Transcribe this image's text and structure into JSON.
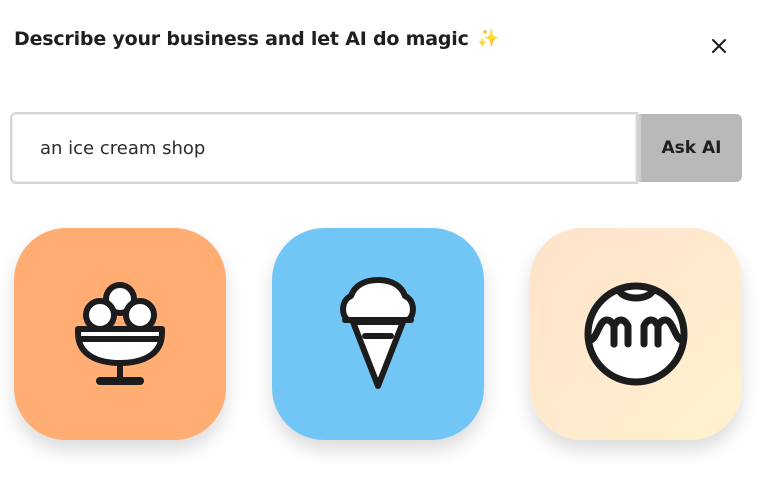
{
  "modal": {
    "title": "Describe your business and let AI do magic",
    "title_emoji": "✨",
    "close_icon": "close-icon"
  },
  "search": {
    "value": "an ice cream shop",
    "placeholder": "",
    "button_label": "Ask AI"
  },
  "results": {
    "icons": [
      {
        "icon": "ice-cream-sundae-icon",
        "background": "#FFAD72"
      },
      {
        "icon": "ice-cream-cone-icon",
        "background": "#72C6F5"
      },
      {
        "icon": "ice-cream-scoop-face-icon",
        "background_from": "#FFE2CC",
        "background_to": "#FFF2CF"
      }
    ]
  },
  "colors": {
    "icon_stroke": "#1c1c1c",
    "button_bg": "#b9b9b9",
    "text": "#1f1f1f"
  }
}
